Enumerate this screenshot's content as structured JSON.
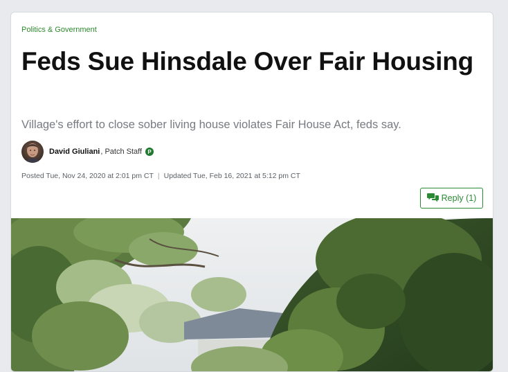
{
  "article": {
    "category": "Politics & Government",
    "title": "Feds Sue Hinsdale Over Fair Housing",
    "subtitle": "Village's effort to close sober living house violates Fair House Act, feds say.",
    "author": {
      "name": "David Giuliani",
      "role": ", Patch Staff",
      "badge": "P"
    },
    "posted": "Posted Tue, Nov 24, 2020 at 2:01 pm CT",
    "separator": "|",
    "updated": "Updated Tue, Feb 16, 2021 at 5:12 pm CT",
    "reply_label": "Reply (1)"
  },
  "colors": {
    "accent_green": "#2a8a34",
    "category_green": "#2d8a2d",
    "title": "#111111",
    "subtitle": "#777b80",
    "page_bg": "#e8eaed"
  },
  "icons": {
    "reply": "chat-bubbles-icon",
    "badge": "patch-p-badge-icon"
  }
}
